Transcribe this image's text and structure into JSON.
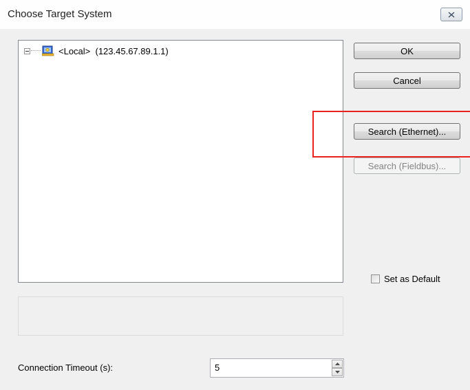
{
  "window": {
    "title": "Choose Target System",
    "close_icon": "close-icon"
  },
  "tree": {
    "items": [
      {
        "expander_icon": "collapse-minus-icon",
        "icon": "target-computer-icon",
        "label": "<Local>  (123.45.67.89.1.1)"
      }
    ]
  },
  "buttons": {
    "ok": "OK",
    "cancel": "Cancel",
    "search_ethernet": "Search (Ethernet)...",
    "search_fieldbus": "Search (Fieldbus)..."
  },
  "set_default": {
    "label": "Set as Default",
    "checked": false
  },
  "timeout": {
    "label": "Connection Timeout (s):",
    "value": "5"
  },
  "colors": {
    "highlight": "#e8211c",
    "dialog_bg": "#f0f0f0"
  }
}
